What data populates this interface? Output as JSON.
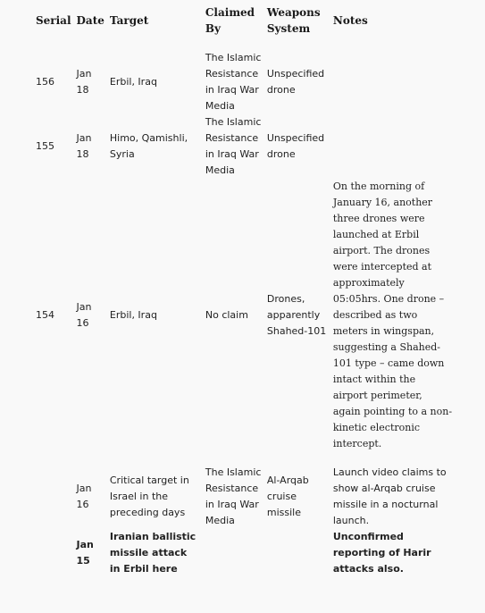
{
  "table": {
    "headers": {
      "serial": "Serial",
      "date": "Date",
      "target": "Target",
      "claimed_by": "Claimed By",
      "weapons_system": "Weapons System",
      "notes": "Notes"
    },
    "rows": [
      {
        "serial": "156",
        "date": "Jan 18",
        "target": "Erbil, Iraq",
        "claimed_by": "The Islamic Resistance in Iraq War Media",
        "weapons_system": "Unspecified drone",
        "notes": ""
      },
      {
        "serial": "155",
        "date": "Jan 18",
        "target": "Himo, Qamishli, Syria",
        "claimed_by": "The Islamic Resistance in Iraq War Media",
        "weapons_system": "Unspecified drone",
        "notes": ""
      },
      {
        "serial": "154",
        "date": "Jan 16",
        "target": "Erbil, Iraq",
        "claimed_by": "No claim",
        "weapons_system": "Drones, apparently Shahed-101",
        "notes": "On the morning of January 16, another three drones were launched at Erbil airport. The drones were intercepted at approximately 05:05hrs. One drone – described as two meters in wingspan, suggesting a Shahed-101 type – came down intact within the airport perimeter, again pointing to a non-kinetic electronic intercept."
      },
      {
        "serial": "",
        "date": "Jan 16",
        "target": "Critical target in Israel in the preceding days",
        "claimed_by": "The Islamic Resistance in Iraq War Media",
        "weapons_system": "Al-Arqab cruise missile",
        "notes": "Launch video claims to show al-Arqab cruise missile in a nocturnal launch."
      },
      {
        "serial": "",
        "date": "Jan 15",
        "target": "Iranian ballistic missile attack in Erbil here",
        "claimed_by": "",
        "weapons_system": "",
        "notes": "Unconfirmed reporting of Harir attacks also."
      }
    ]
  }
}
